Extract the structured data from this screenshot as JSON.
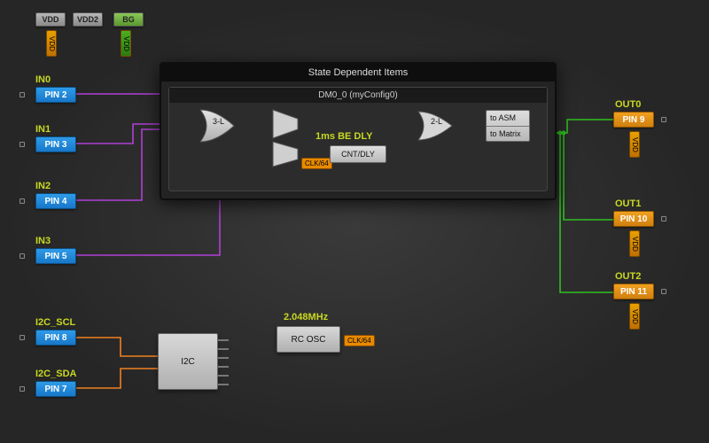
{
  "top_rail": {
    "vdd": "VDD",
    "vdd2": "VDD2",
    "bg": "BG",
    "vdd_tag": "VDD",
    "bg_tag": "VDD"
  },
  "inputs": {
    "in0": {
      "net": "IN0",
      "pin": "PIN 2"
    },
    "in1": {
      "net": "IN1",
      "pin": "PIN 3"
    },
    "in2": {
      "net": "IN2",
      "pin": "PIN 4"
    },
    "in3": {
      "net": "IN3",
      "pin": "PIN 5"
    },
    "scl": {
      "net": "I2C_SCL",
      "pin": "PIN 8"
    },
    "sda": {
      "net": "I2C_SDA",
      "pin": "PIN 7"
    }
  },
  "outputs": {
    "out0": {
      "net": "OUT0",
      "pin": "PIN 9"
    },
    "out1": {
      "net": "OUT1",
      "pin": "PIN 10"
    },
    "out2": {
      "net": "OUT2",
      "pin": "PIN 11"
    },
    "vdd_tag": "VDD"
  },
  "state_frame": {
    "title": "State Dependent Items",
    "subtitle": "DM0_0 (myConfig0)",
    "lut3": "3-L",
    "lut2": "2-L",
    "delay_label": "1ms BE DLY",
    "cnt_dly": "CNT/DLY",
    "clk_tag": "CLK/64",
    "out_top": "to ASM",
    "out_bot": "to Matrix"
  },
  "i2c": {
    "label": "I2C"
  },
  "osc": {
    "freq": "2.048MHz",
    "label": "RC OSC",
    "clk_tag": "CLK/64"
  },
  "chart_data": {
    "type": "diagram",
    "nodes": [
      {
        "id": "VDD",
        "kind": "power-pin"
      },
      {
        "id": "VDD2",
        "kind": "power-pin"
      },
      {
        "id": "BG",
        "kind": "power-pin"
      },
      {
        "id": "PIN2",
        "kind": "io-pin",
        "net": "IN0"
      },
      {
        "id": "PIN3",
        "kind": "io-pin",
        "net": "IN1"
      },
      {
        "id": "PIN4",
        "kind": "io-pin",
        "net": "IN2"
      },
      {
        "id": "PIN5",
        "kind": "io-pin",
        "net": "IN3"
      },
      {
        "id": "PIN8",
        "kind": "io-pin",
        "net": "I2C_SCL"
      },
      {
        "id": "PIN7",
        "kind": "io-pin",
        "net": "I2C_SDA"
      },
      {
        "id": "PIN9",
        "kind": "io-pin",
        "net": "OUT0"
      },
      {
        "id": "PIN10",
        "kind": "io-pin",
        "net": "OUT1"
      },
      {
        "id": "PIN11",
        "kind": "io-pin",
        "net": "OUT2"
      },
      {
        "id": "LUT3",
        "kind": "lut",
        "label": "3-L"
      },
      {
        "id": "MUX1",
        "kind": "mux"
      },
      {
        "id": "MUX2",
        "kind": "mux"
      },
      {
        "id": "CNT_DLY",
        "kind": "counter-delay",
        "label": "CNT/DLY",
        "param": "1ms BE DLY",
        "clock": "CLK/64"
      },
      {
        "id": "LUT2",
        "kind": "lut",
        "label": "2-L"
      },
      {
        "id": "OUTSEL",
        "kind": "output-select",
        "options": [
          "to ASM",
          "to Matrix"
        ]
      },
      {
        "id": "I2C",
        "kind": "i2c-block"
      },
      {
        "id": "RC_OSC",
        "kind": "oscillator",
        "freq": "2.048MHz",
        "tap": "CLK/64"
      }
    ],
    "edges": [
      {
        "from": "PIN2",
        "to": "LUT3",
        "color": "purple"
      },
      {
        "from": "PIN3",
        "to": "LUT3",
        "color": "purple"
      },
      {
        "from": "PIN4",
        "to": "LUT3",
        "color": "purple"
      },
      {
        "from": "PIN5",
        "to": "MUX2",
        "color": "purple"
      },
      {
        "from": "LUT3",
        "to": "MUX1",
        "color": "orange"
      },
      {
        "from": "MUX1",
        "to": "LUT2",
        "color": "orange"
      },
      {
        "from": "MUX2",
        "to": "CNT_DLY",
        "color": "orange"
      },
      {
        "from": "CNT_DLY",
        "to": "LUT2",
        "color": "orange"
      },
      {
        "from": "RC_OSC",
        "to": "CNT_DLY",
        "label": "CLK/64",
        "color": "orange"
      },
      {
        "from": "LUT2",
        "to": "OUTSEL",
        "color": "orange"
      },
      {
        "from": "OUTSEL",
        "to": "PIN9",
        "color": "green"
      },
      {
        "from": "OUTSEL",
        "to": "PIN10",
        "color": "green"
      },
      {
        "from": "OUTSEL",
        "to": "PIN11",
        "color": "green"
      },
      {
        "from": "PIN8",
        "to": "I2C",
        "color": "orange"
      },
      {
        "from": "PIN7",
        "to": "I2C",
        "color": "orange"
      }
    ],
    "containers": [
      {
        "id": "StateDependentItems",
        "label": "State Dependent Items",
        "children": [
          "DM0_0"
        ]
      },
      {
        "id": "DM0_0",
        "label": "DM0_0 (myConfig0)",
        "children": [
          "LUT3",
          "MUX1",
          "MUX2",
          "CNT_DLY",
          "LUT2",
          "OUTSEL"
        ]
      }
    ]
  }
}
